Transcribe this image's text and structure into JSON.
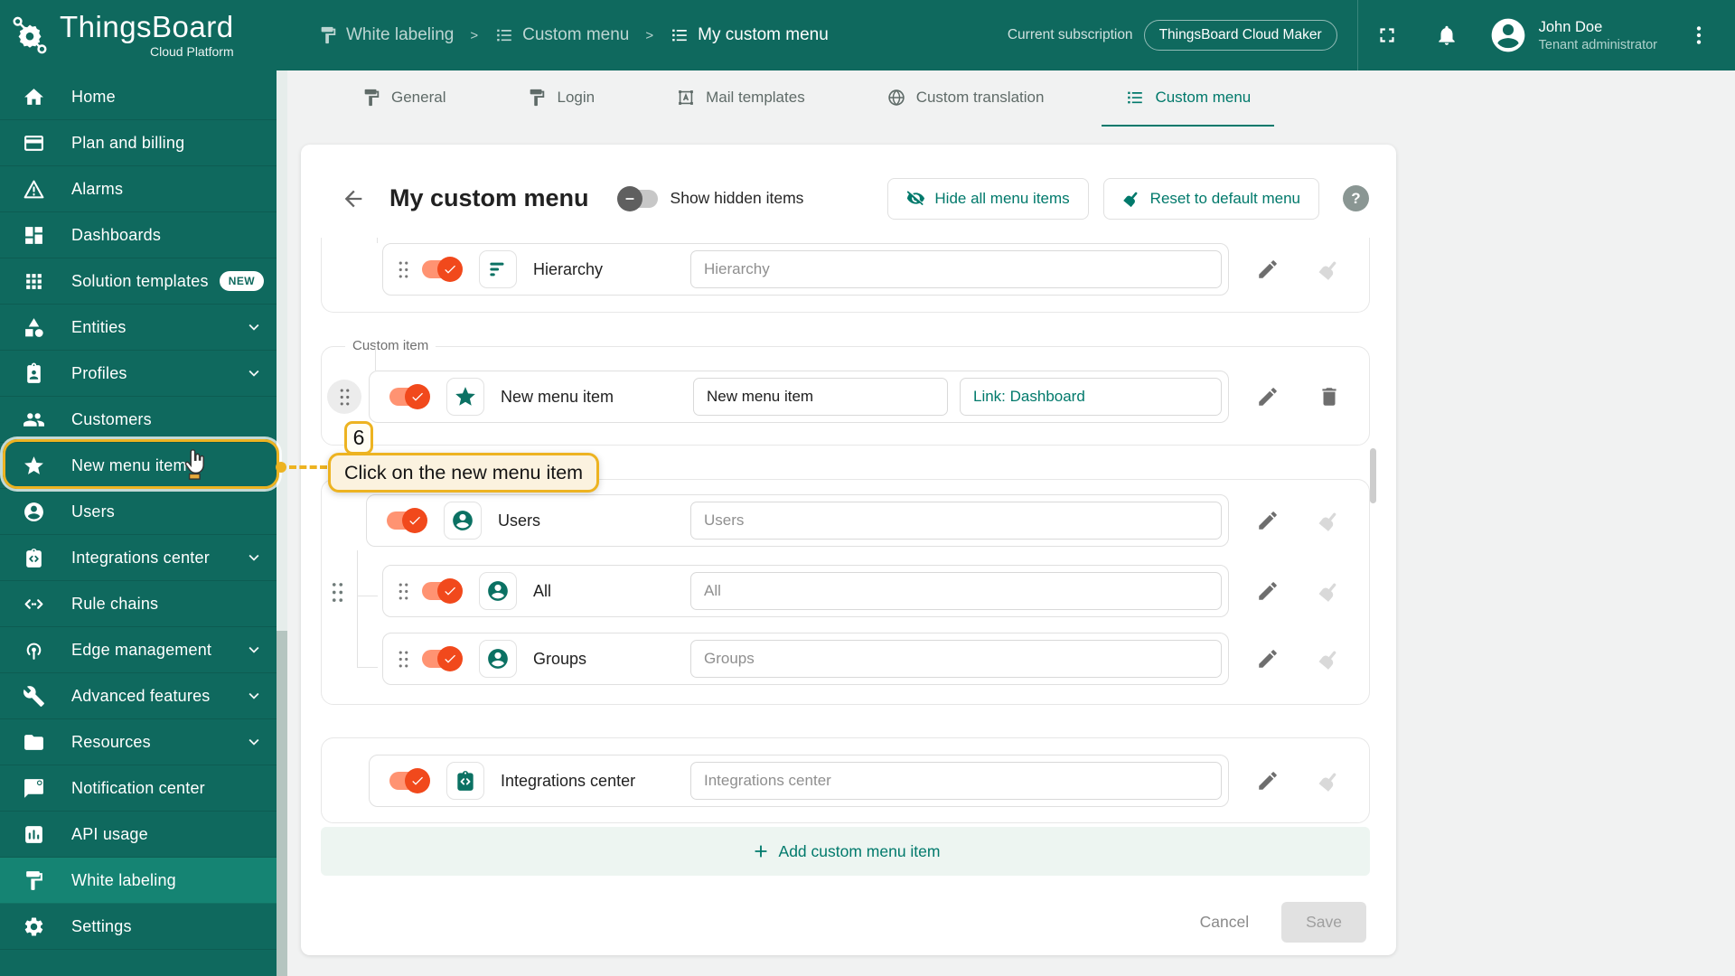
{
  "colors": {
    "primary_teal": "#00796b",
    "sidebar_teal": "#0f695e",
    "sidebar_active_teal": "#158473",
    "toggle_on_track": "#ff9372",
    "toggle_on_thumb": "#f1491c",
    "coach_gold": "#edb321",
    "coach_bg": "#fbf2df"
  },
  "header": {
    "logo_title": "ThingsBoard",
    "logo_subtitle": "Cloud Platform",
    "breadcrumb": [
      {
        "label": "White labeling",
        "icon": "paint-roller-icon"
      },
      {
        "label": "Custom menu",
        "icon": "list-icon"
      },
      {
        "label": "My custom menu",
        "icon": "list-icon"
      }
    ],
    "separator": ">",
    "subscription_label": "Current subscription",
    "subscription_value": "ThingsBoard Cloud Maker",
    "icons": [
      "fullscreen-icon",
      "bell-icon",
      "avatar",
      "kebab-menu-icon"
    ],
    "user": {
      "name": "John Doe",
      "role": "Tenant administrator"
    }
  },
  "sidebar": {
    "items": [
      {
        "label": "Home",
        "icon": "home-icon"
      },
      {
        "label": "Plan and billing",
        "icon": "credit-card-icon"
      },
      {
        "label": "Alarms",
        "icon": "warning-icon"
      },
      {
        "label": "Dashboards",
        "icon": "dashboards-icon"
      },
      {
        "label": "Solution templates",
        "icon": "apps-grid-icon",
        "badge": "NEW"
      },
      {
        "label": "Entities",
        "icon": "category-icon",
        "expandable": true
      },
      {
        "label": "Profiles",
        "icon": "id-badge-icon",
        "expandable": true
      },
      {
        "label": "Customers",
        "icon": "people-icon"
      },
      {
        "label": "New menu item",
        "icon": "star-icon",
        "highlighted": true
      },
      {
        "label": "Users",
        "icon": "person-circle-icon"
      },
      {
        "label": "Integrations center",
        "icon": "integrations-icon",
        "expandable": true
      },
      {
        "label": "Rule chains",
        "icon": "rule-chain-icon"
      },
      {
        "label": "Edge management",
        "icon": "edge-antenna-icon",
        "expandable": true
      },
      {
        "label": "Advanced features",
        "icon": "tools-icon",
        "expandable": true
      },
      {
        "label": "Resources",
        "icon": "folder-icon",
        "expandable": true
      },
      {
        "label": "Notification center",
        "icon": "notification-icon"
      },
      {
        "label": "API usage",
        "icon": "api-chart-icon"
      },
      {
        "label": "White labeling",
        "icon": "paint-roller-icon",
        "active": true
      },
      {
        "label": "Settings",
        "icon": "gear-icon"
      }
    ]
  },
  "tabs": {
    "items": [
      {
        "label": "General",
        "icon": "paint-roller-icon"
      },
      {
        "label": "Login",
        "icon": "paint-roller-icon"
      },
      {
        "label": "Mail templates",
        "icon": "mail-template-icon"
      },
      {
        "label": "Custom translation",
        "icon": "globe-icon"
      },
      {
        "label": "Custom menu",
        "icon": "list-icon",
        "active": true
      }
    ]
  },
  "content": {
    "title": "My custom menu",
    "show_hidden_label": "Show hidden items",
    "hide_all_button": "Hide all menu items",
    "reset_button": "Reset to default menu",
    "help_glyph": "?",
    "custom_item_legend": "Custom item",
    "rows": {
      "hierarchy": {
        "label": "Hierarchy",
        "placeholder": "Hierarchy"
      },
      "custom": {
        "label": "New menu item",
        "name_value": "New menu item",
        "link_value": "Link: Dashboard"
      },
      "users": {
        "label": "Users",
        "placeholder": "Users"
      },
      "all": {
        "label": "All",
        "placeholder": "All"
      },
      "groups": {
        "label": "Groups",
        "placeholder": "Groups"
      },
      "integrations": {
        "label": "Integrations center",
        "placeholder": "Integrations center"
      }
    },
    "add_button": "Add custom menu item",
    "cancel_button": "Cancel",
    "save_button": "Save"
  },
  "coach": {
    "step": "6",
    "text": "Click on the new menu item"
  }
}
